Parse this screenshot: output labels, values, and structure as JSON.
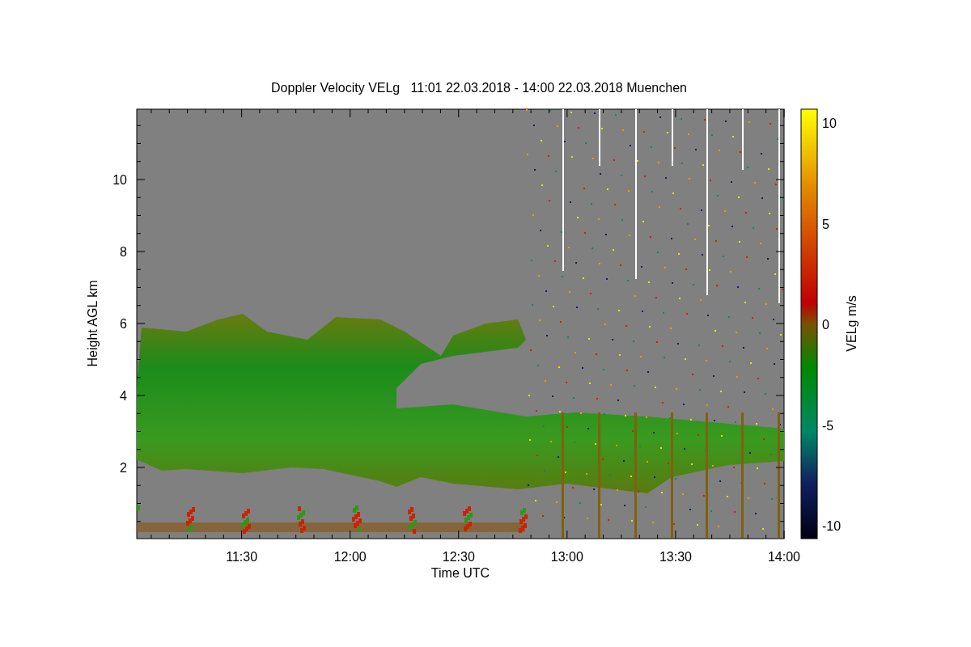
{
  "title": "Doppler Velocity VELg   11:01 22.03.2018 - 14:00 22.03.2018 Muenchen",
  "y_axis": {
    "label": "Height AGL km",
    "ticks": [
      "10",
      "8",
      "6",
      "4",
      "2"
    ]
  },
  "x_axis": {
    "label": "Time UTC",
    "ticks": [
      "11:30",
      "12:00",
      "12:30",
      "13:00",
      "13:30",
      "14:00"
    ]
  },
  "colorbar": {
    "label": "VELg m/s",
    "ticks": [
      "10",
      "5",
      "0",
      "-5",
      "-10"
    ]
  }
}
